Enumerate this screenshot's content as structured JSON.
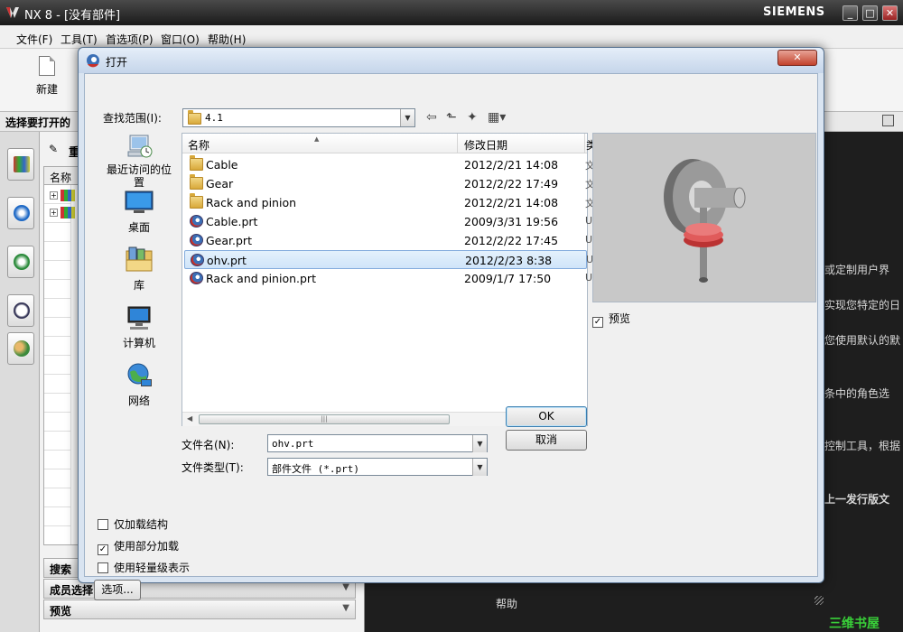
{
  "app": {
    "title": "NX 8 - [没有部件]",
    "brand": "SIEMENS",
    "menu": [
      "文件(F)",
      "工具(T)",
      "首选项(P)",
      "窗口(O)",
      "帮助(H)"
    ],
    "new_label": "新建",
    "info_bar": "选择要打开的",
    "nav_title": "重",
    "nav_column": "名称",
    "sections": [
      "搜索",
      "成员选择",
      "预览"
    ],
    "main_lines": [
      "或定制用户界",
      "实现您特定的日",
      "您使用默认的默",
      "条中的角色选",
      "控制工具，根据",
      "上一发行版文"
    ],
    "help_label": "帮助",
    "watermark": "三维书屋"
  },
  "dialog": {
    "title": "打开",
    "close": "✕",
    "look_in_label": "查找范围(I):",
    "look_in_value": "4.1",
    "places": [
      {
        "label": "最近访问的位置",
        "icon": "recent-places-icon"
      },
      {
        "label": "桌面",
        "icon": "desktop-icon"
      },
      {
        "label": "库",
        "icon": "libraries-icon"
      },
      {
        "label": "计算机",
        "icon": "computer-icon"
      },
      {
        "label": "网络",
        "icon": "network-icon"
      }
    ],
    "columns": {
      "name": "名称",
      "date": "修改日期",
      "extra": "类"
    },
    "files": [
      {
        "name": "Cable",
        "date": "2012/2/21 14:08",
        "ext": "文",
        "type": "folder"
      },
      {
        "name": "Gear",
        "date": "2012/2/22 17:49",
        "ext": "文",
        "type": "folder"
      },
      {
        "name": "Rack and pinion",
        "date": "2012/2/21 14:08",
        "ext": "文",
        "type": "folder"
      },
      {
        "name": "Cable.prt",
        "date": "2009/3/31 19:56",
        "ext": "U",
        "type": "prt"
      },
      {
        "name": "Gear.prt",
        "date": "2012/2/22 17:45",
        "ext": "U",
        "type": "prt"
      },
      {
        "name": "ohv.prt",
        "date": "2012/2/23 8:38",
        "ext": "U",
        "type": "prt",
        "selected": true
      },
      {
        "name": "Rack and pinion.prt",
        "date": "2009/1/7 17:50",
        "ext": "U",
        "type": "prt"
      }
    ],
    "preview_label": "预览",
    "preview_checked": true,
    "filename_label": "文件名(N):",
    "filename_value": "ohv.prt",
    "filetype_label": "文件类型(T):",
    "filetype_value": "部件文件 (*.prt)",
    "ok_label": "OK",
    "cancel_label": "取消",
    "options": [
      {
        "label": "仅加载结构",
        "checked": false
      },
      {
        "label": "使用部分加载",
        "checked": true
      },
      {
        "label": "使用轻量级表示",
        "checked": false
      }
    ],
    "options_button": "选项..."
  },
  "colors": {
    "selection": "#cfe4f9",
    "dialog_frame": "#d9e4f1",
    "watermark": "#39d139"
  }
}
